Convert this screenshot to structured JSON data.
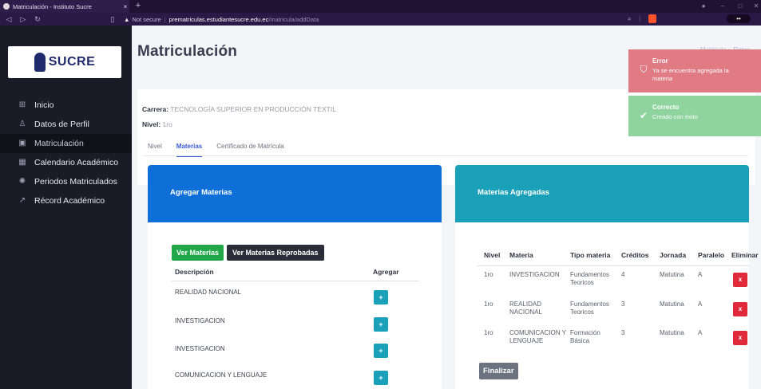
{
  "browser": {
    "tab_title": "Matriculación - Instituto Sucre",
    "tab_close": "×",
    "new_tab": "+",
    "security": "Not secure",
    "url_host": "prematriculas.estudiantesucre.edu.ec",
    "url_path": "/matricula/addData"
  },
  "sidebar": {
    "logo_text": "SUCRE",
    "items": [
      {
        "label": "Inicio",
        "icon": "grid-icon"
      },
      {
        "label": "Datos de Perfil",
        "icon": "user-icon"
      },
      {
        "label": "Matriculación",
        "icon": "matricula-icon"
      },
      {
        "label": "Calendario Académico",
        "icon": "calendar-icon"
      },
      {
        "label": "Periodos Matriculados",
        "icon": "periods-icon"
      },
      {
        "label": "Récord Académico",
        "icon": "chart-icon"
      }
    ]
  },
  "main": {
    "title": "Matriculación",
    "breadcrumb": "Matricula » Datos",
    "career_label": "Carrera:",
    "career_value": "TECNOLOGÍA SUPERIOR EN PRODUCCIÓN TEXTIL",
    "level_label": "Nivel:",
    "level_value": "1ro",
    "tabs": [
      "Nivel",
      "Materias",
      "Certificado de Matrícula"
    ]
  },
  "left_card": {
    "title": "Agregar Materias",
    "btn_ver": "Ver Materias",
    "btn_reprobadas": "Ver Materias Reprobadas",
    "col_desc": "Descripción",
    "col_add": "Agregar",
    "add_symbol": "+",
    "rows": [
      "REALIDAD NACIONAL",
      "INVESTIGACION",
      "INVESTIGACION",
      "COMUNICACION Y LENGUAJE"
    ]
  },
  "right_card": {
    "title": "Materias Agregadas",
    "columns": [
      "Nivel",
      "Materia",
      "Tipo materia",
      "Créditos",
      "Jornada",
      "Paralelo",
      "Eliminar"
    ],
    "delete_symbol": "x",
    "rows": [
      {
        "nivel": "1ro",
        "materia": "INVESTIGACION",
        "tipo": "Fundamentos Teoricos",
        "creditos": "4",
        "jornada": "Matutina",
        "paralelo": "A"
      },
      {
        "nivel": "1ro",
        "materia": "REALIDAD NACIONAL",
        "tipo": "Fundamentos Teoricos",
        "creditos": "3",
        "jornada": "Matutina",
        "paralelo": "A"
      },
      {
        "nivel": "1ro",
        "materia": "COMUNICACION Y LENGUAJE",
        "tipo": "Formación Básica",
        "creditos": "3",
        "jornada": "Matutina",
        "paralelo": "A"
      }
    ],
    "finalize": "Finalizar"
  },
  "toasts": {
    "error_title": "Error",
    "error_msg": "Ya se encuentra agregada la materia",
    "ok_title": "Correcto",
    "ok_msg": "Creado con éxito"
  }
}
